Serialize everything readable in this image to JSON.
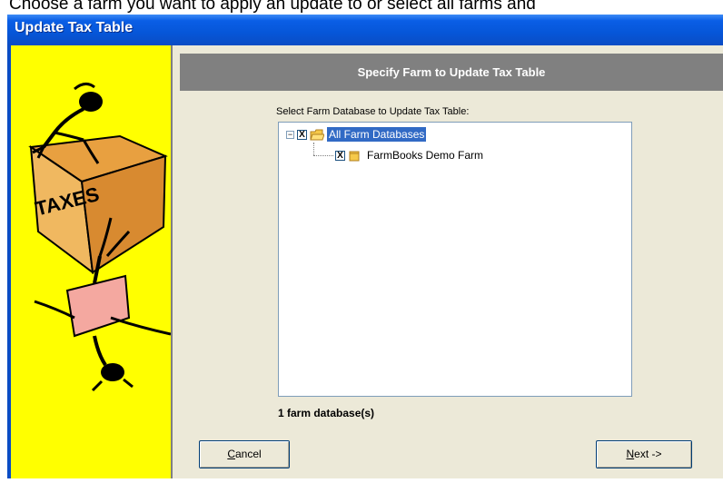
{
  "instruction": "Choose a farm you want to apply an update to or select all farms and",
  "window": {
    "title": "Update Tax Table"
  },
  "header": {
    "title": "Specify Farm to Update Tax Table"
  },
  "tree": {
    "label": "Select Farm Database to Update Tax Table:",
    "root": {
      "label": "All Farm Databases",
      "checked": "X",
      "expander": "−"
    },
    "children": [
      {
        "label": "FarmBooks Demo Farm",
        "checked": "X"
      }
    ]
  },
  "count_text": "1 farm database(s)",
  "buttons": {
    "cancel": {
      "first": "C",
      "rest": "ancel"
    },
    "next": {
      "first": "N",
      "rest": "ext ->"
    }
  },
  "art": {
    "desk_text": "TAXES"
  },
  "colors": {
    "title_bar": "#0a5ee6",
    "art_background": "#ffff00",
    "header_bar": "#808080",
    "selection": "#316ac5"
  }
}
